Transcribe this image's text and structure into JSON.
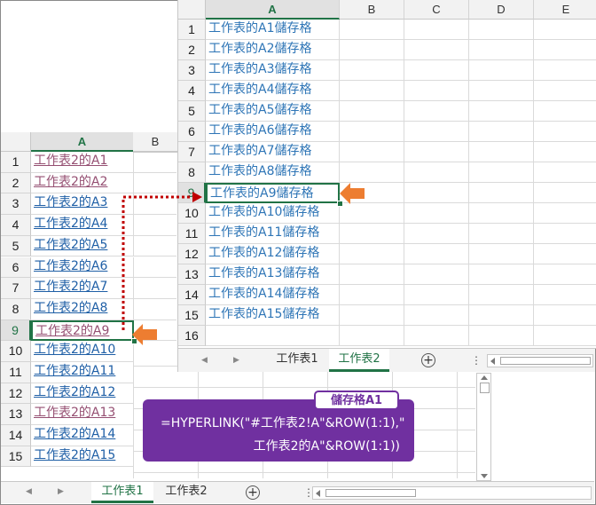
{
  "left_sheet": {
    "columns": [
      "A",
      "B"
    ],
    "rows": [
      {
        "num": "1",
        "text": "工作表2的A1",
        "style": "visited"
      },
      {
        "num": "2",
        "text": "工作表2的A2",
        "style": "visited"
      },
      {
        "num": "3",
        "text": "工作表2的A3",
        "style": "ul"
      },
      {
        "num": "4",
        "text": "工作表2的A4",
        "style": "ul"
      },
      {
        "num": "5",
        "text": "工作表2的A5",
        "style": "ul"
      },
      {
        "num": "6",
        "text": "工作表2的A6",
        "style": "ul"
      },
      {
        "num": "7",
        "text": "工作表2的A7",
        "style": "ul"
      },
      {
        "num": "8",
        "text": "工作表2的A8",
        "style": "ul"
      },
      {
        "num": "9",
        "text": "工作表2的A9",
        "style": "visited"
      },
      {
        "num": "10",
        "text": "工作表2的A10",
        "style": "ul"
      },
      {
        "num": "11",
        "text": "工作表2的A11",
        "style": "ul"
      },
      {
        "num": "12",
        "text": "工作表2的A12",
        "style": "ul"
      },
      {
        "num": "13",
        "text": "工作表2的A13",
        "style": "visited"
      },
      {
        "num": "14",
        "text": "工作表2的A14",
        "style": "ul"
      },
      {
        "num": "15",
        "text": "工作表2的A15",
        "style": "ul"
      }
    ],
    "tabs": [
      "工作表1",
      "工作表2"
    ],
    "active_tab": 0
  },
  "right_sheet": {
    "columns": [
      "A",
      "B",
      "C",
      "D",
      "E"
    ],
    "rows": [
      {
        "num": "1",
        "text": "工作表的A1儲存格"
      },
      {
        "num": "2",
        "text": "工作表的A2儲存格"
      },
      {
        "num": "3",
        "text": "工作表的A3儲存格"
      },
      {
        "num": "4",
        "text": "工作表的A4儲存格"
      },
      {
        "num": "5",
        "text": "工作表的A5儲存格"
      },
      {
        "num": "6",
        "text": "工作表的A6儲存格"
      },
      {
        "num": "7",
        "text": "工作表的A7儲存格"
      },
      {
        "num": "8",
        "text": "工作表的A8儲存格"
      },
      {
        "num": "9",
        "text": "工作表的A9儲存格"
      },
      {
        "num": "10",
        "text": "工作表的A10儲存格"
      },
      {
        "num": "11",
        "text": "工作表的A11儲存格"
      },
      {
        "num": "12",
        "text": "工作表的A12儲存格"
      },
      {
        "num": "13",
        "text": "工作表的A13儲存格"
      },
      {
        "num": "14",
        "text": "工作表的A14儲存格"
      },
      {
        "num": "15",
        "text": "工作表的A15儲存格"
      },
      {
        "num": "16",
        "text": ""
      }
    ],
    "tabs": [
      "工作表1",
      "工作表2"
    ],
    "active_tab": 1
  },
  "callout": {
    "label": "儲存格A1",
    "line1": "=HYPERLINK(\"#工作表2!A\"&ROW(1:1),\"",
    "line2": "工作表2的A\"&ROW(1:1))"
  },
  "colors": {
    "accent": "#217346",
    "link": "#2e75b6",
    "visited": "#954f72",
    "callout": "#7030a0",
    "arrow": "#ed7d31",
    "connector": "#c00000"
  },
  "icons": [
    "orange-arrow-icon",
    "add-sheet-icon",
    "tab-nav-left-icon",
    "tab-nav-right-icon"
  ]
}
